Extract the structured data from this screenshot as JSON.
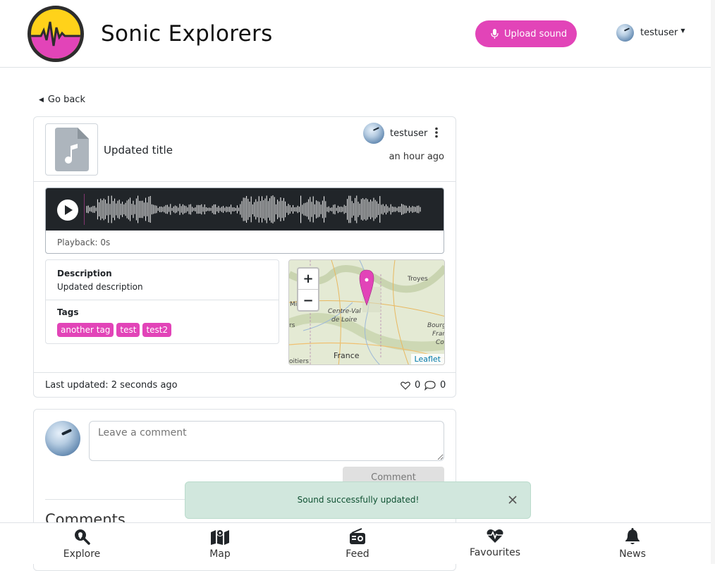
{
  "header": {
    "brand": "Sonic Explorers",
    "upload_label": "Upload sound",
    "username": "testuser"
  },
  "nav": {
    "go_back": "Go back"
  },
  "sound": {
    "title": "Updated title",
    "owner": "testuser",
    "time_ago": "an hour ago",
    "playback": "Playback: 0s",
    "description_label": "Description",
    "description": "Updated description",
    "tags_label": "Tags",
    "tags": [
      "another tag",
      "test",
      "test2"
    ],
    "last_updated": "Last updated: 2 seconds ago",
    "likes": "0",
    "comments": "0"
  },
  "map": {
    "zoom_in": "+",
    "zoom_out": "−",
    "attribution": "Leaflet",
    "labels": {
      "troyes": "Troyes",
      "centre": "Centre-Val",
      "de_loire": "de Loire",
      "france": "France",
      "poitiers": "oitiers",
      "bour": "Bourg",
      "fran": "Fran",
      "co": "Co",
      "mi": "Mi",
      "rs": "rs"
    }
  },
  "comment_form": {
    "placeholder": "Leave a comment",
    "button": "Comment",
    "heading": "Comments"
  },
  "toast": {
    "message": "Sound successfully updated!"
  },
  "bottom_nav": {
    "explore": "Explore",
    "map": "Map",
    "feed": "Feed",
    "favourites": "Favourites",
    "news": "News"
  },
  "colors": {
    "accent": "#e244b8",
    "toast_bg": "#d1e7dd",
    "dark": "#212529"
  }
}
